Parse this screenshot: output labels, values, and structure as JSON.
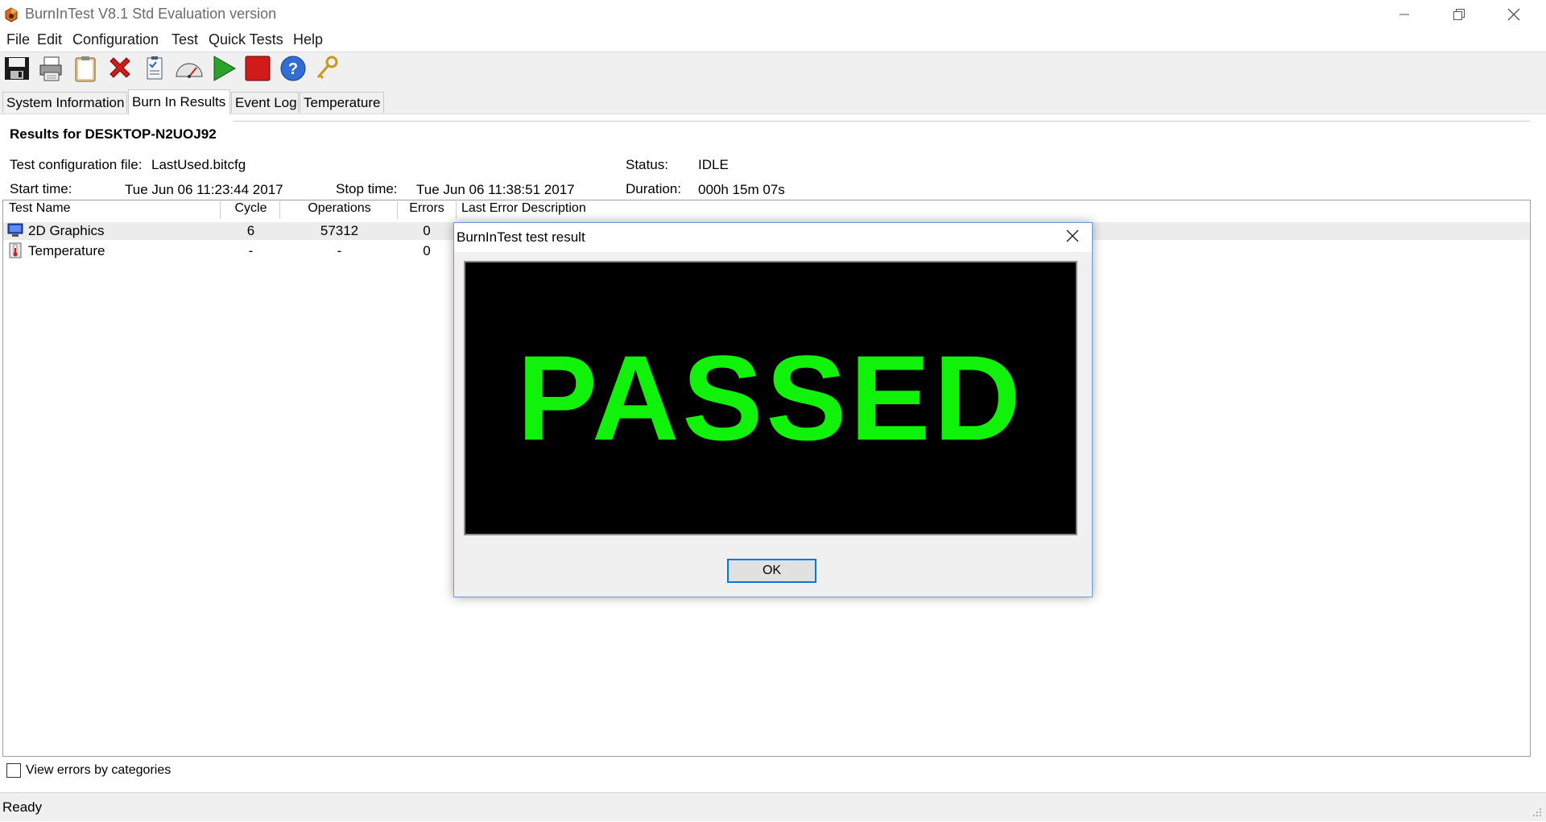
{
  "window": {
    "title": "BurnInTest V8.1 Std Evaluation version"
  },
  "menu": [
    "File",
    "Edit",
    "Configuration",
    "Test",
    "Quick Tests",
    "Help"
  ],
  "toolbar": {
    "icons": [
      "save-icon",
      "printer-icon",
      "clipboard-icon",
      "close-icon",
      "config-file-icon",
      "speedometer-icon",
      "play-icon",
      "stop-icon",
      "help-icon",
      "key-icon"
    ]
  },
  "tabs": [
    {
      "label": "System Information",
      "active": false
    },
    {
      "label": "Burn In Results",
      "active": true
    },
    {
      "label": "Event Log",
      "active": false
    },
    {
      "label": "Temperature",
      "active": false
    }
  ],
  "results": {
    "heading": "Results for DESKTOP-N2UOJ92",
    "config_label": "Test configuration file:",
    "config_value": "LastUsed.bitcfg",
    "status_label": "Status:",
    "status_value": "IDLE",
    "start_label": "Start time:",
    "start_value": "Tue Jun 06 11:23:44 2017",
    "stop_label": "Stop time:",
    "stop_value": "Tue Jun 06 11:38:51 2017",
    "duration_label": "Duration:",
    "duration_value": "000h 15m 07s"
  },
  "table": {
    "columns": [
      "Test Name",
      "Cycle",
      "Operations",
      "Errors",
      "Last Error Description"
    ],
    "rows": [
      {
        "name": "2D Graphics",
        "cycle": "6",
        "operations": "57312",
        "errors": "0",
        "desc": ""
      },
      {
        "name": "Temperature",
        "cycle": "-",
        "operations": "-",
        "errors": "0",
        "desc": ""
      }
    ]
  },
  "checkbox": {
    "label": "View errors by categories",
    "checked": false
  },
  "statusbar": {
    "text": "Ready"
  },
  "dialog": {
    "title": "BurnInTest test result",
    "result": "PASSED",
    "ok_label": "OK",
    "result_color": "#11f20a"
  }
}
